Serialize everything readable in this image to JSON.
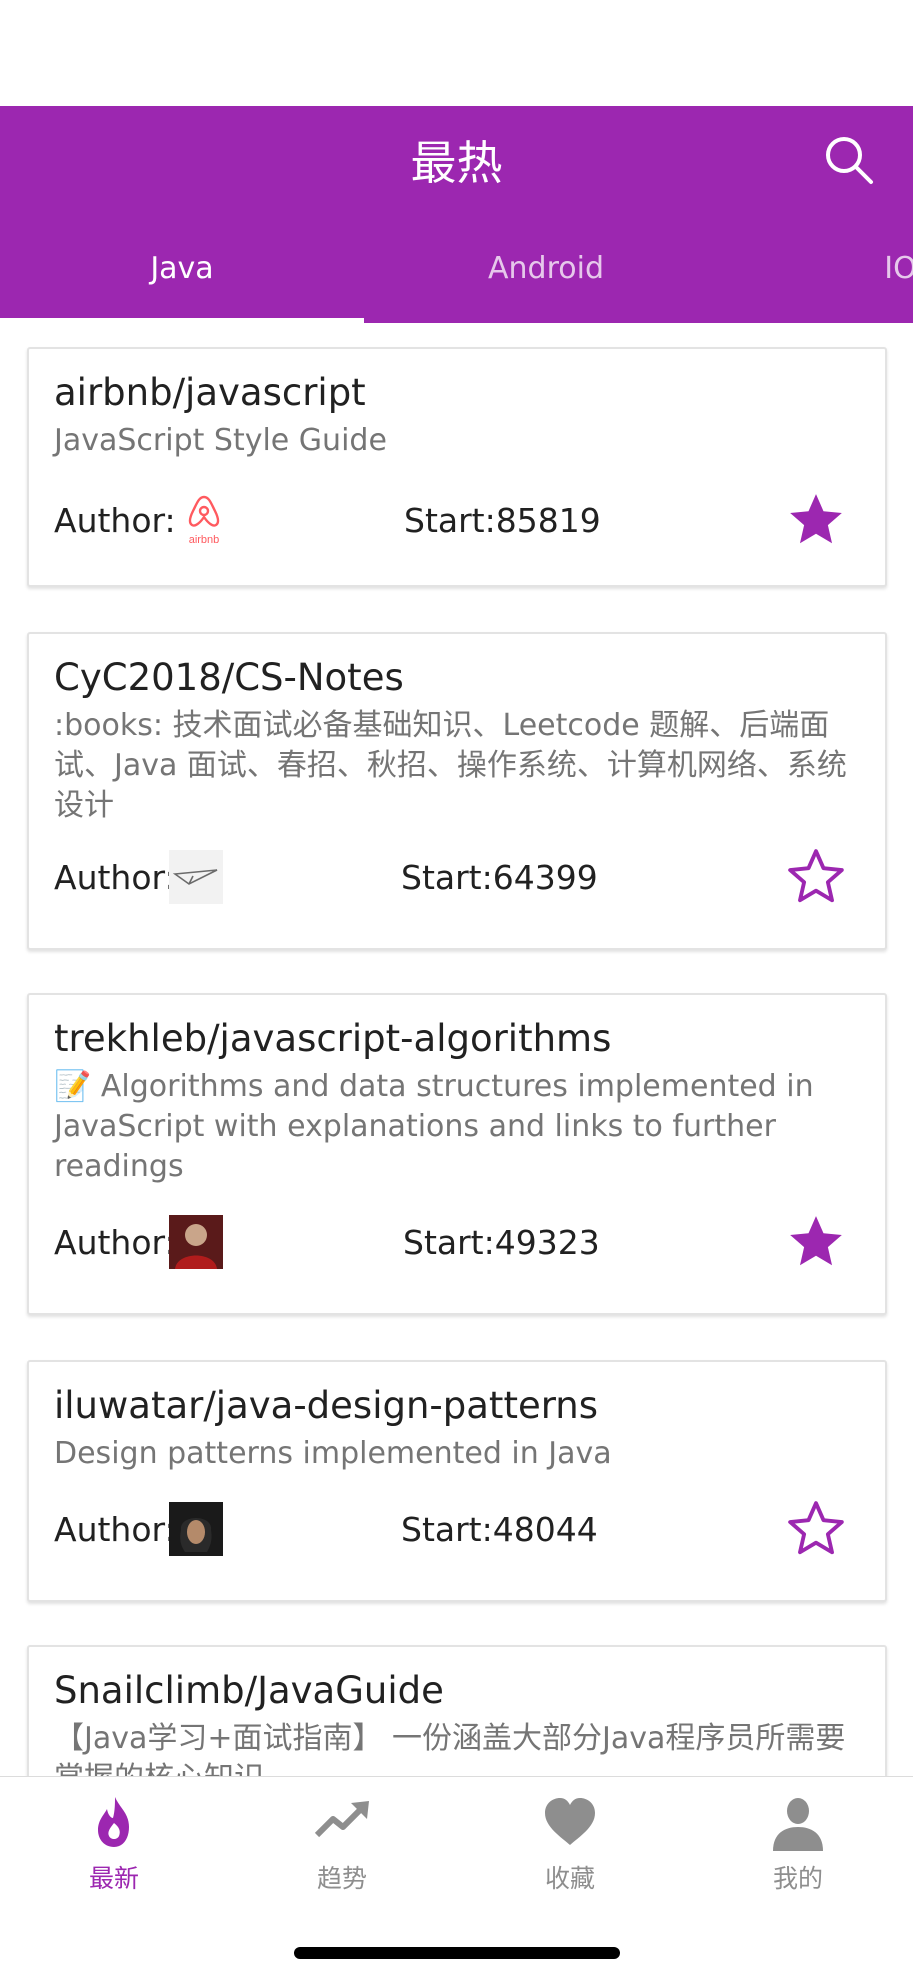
{
  "header": {
    "title": "最热",
    "tabs": [
      {
        "label": "Java",
        "active": true
      },
      {
        "label": "Android",
        "active": false
      },
      {
        "label": "IOS",
        "active": false
      }
    ]
  },
  "colors": {
    "accent": "#9c27b0",
    "inactive": "#8e8e8e"
  },
  "repos": [
    {
      "name": "airbnb/javascript",
      "description": "JavaScript Style Guide",
      "author_label": "Author:",
      "stars": "Start:85819",
      "favorited": true,
      "avatar": "airbnb-logo"
    },
    {
      "name": "CyC2018/CS-Notes",
      "description": ":books: 技术面试必备基础知识、Leetcode 题解、后端面试、Java 面试、春招、秋招、操作系统、计算机网络、系统设计",
      "author_label": "Author:",
      "stars": "Start:64399",
      "favorited": false,
      "avatar": "paper-plane"
    },
    {
      "name": "trekhleb/javascript-algorithms",
      "description": "📝 Algorithms and data structures implemented in JavaScript with explanations and links to further readings",
      "author_label": "Author:",
      "stars": "Start:49323",
      "favorited": true,
      "avatar": "user-photo"
    },
    {
      "name": "iluwatar/java-design-patterns",
      "description": "Design patterns implemented in Java",
      "author_label": "Author:",
      "stars": "Start:48044",
      "favorited": false,
      "avatar": "user-photo"
    },
    {
      "name": "Snailclimb/JavaGuide",
      "description": "【Java学习+面试指南】 一份涵盖大部分Java程序员所需要掌握的核心知识。"
    }
  ],
  "tabbar": [
    {
      "label": "最新",
      "icon": "flame-icon",
      "active": true
    },
    {
      "label": "趋势",
      "icon": "trending-icon",
      "active": false
    },
    {
      "label": "收藏",
      "icon": "heart-icon",
      "active": false
    },
    {
      "label": "我的",
      "icon": "user-icon",
      "active": false
    }
  ]
}
